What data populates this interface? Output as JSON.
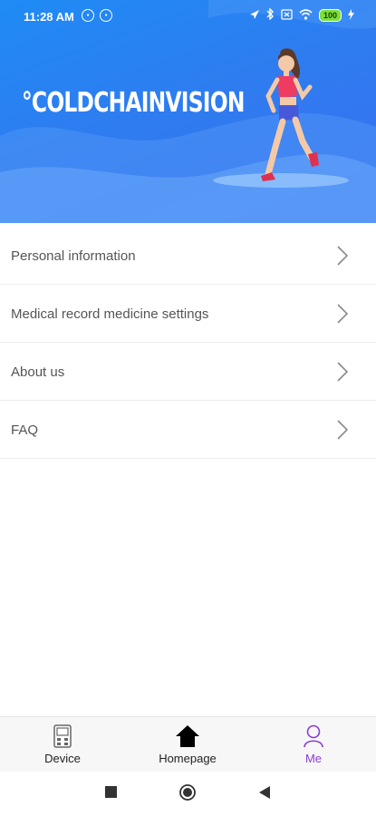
{
  "status_bar": {
    "time": "11:28 AM",
    "battery": "100",
    "icons": [
      "app-icon",
      "app-icon-2",
      "location-icon",
      "bluetooth-icon",
      "sim-icon",
      "wifi-icon",
      "battery-icon",
      "charging-icon"
    ]
  },
  "header": {
    "brand": "°COLDCHAINVISION",
    "colors": {
      "gradient_start": "#1f8bf5",
      "gradient_end": "#3a6ef0"
    }
  },
  "menu": {
    "items": [
      {
        "label": "Personal information"
      },
      {
        "label": "Medical record medicine settings"
      },
      {
        "label": "About us"
      },
      {
        "label": "FAQ"
      }
    ]
  },
  "tabbar": {
    "tabs": [
      {
        "label": "Device",
        "icon": "device-icon"
      },
      {
        "label": "Homepage",
        "icon": "home-icon"
      },
      {
        "label": "Me",
        "icon": "person-icon",
        "active": true
      }
    ],
    "active_color": "#8a3dd6"
  },
  "nav": {
    "icons": [
      "recent-apps-icon",
      "home-nav-icon",
      "back-icon"
    ]
  }
}
